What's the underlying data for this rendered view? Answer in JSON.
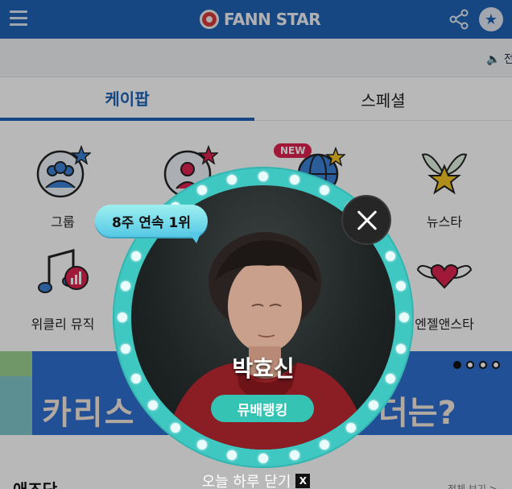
{
  "header": {
    "logo_text": "FANN STAR",
    "menu_icon": "hamburger-icon",
    "share_icon": "share-icon",
    "favorite_icon": "star-icon"
  },
  "notice": {
    "text": "🔈 전"
  },
  "tabs": [
    {
      "label": "케이팝",
      "active": true
    },
    {
      "label": "스페셜",
      "active": false
    }
  ],
  "menu": {
    "new_badge": "NEW",
    "items": [
      {
        "label": "그룹",
        "icon": "group-icon"
      },
      {
        "label": "",
        "icon": "person-icon"
      },
      {
        "label": "",
        "icon": "globe-icon"
      },
      {
        "label": "뉴스타",
        "icon": "new-star-icon"
      },
      {
        "label": "위클리 뮤직",
        "icon": "music-chart-icon"
      },
      {
        "label": "엔젤앤스타",
        "icon": "winged-heart-icon"
      }
    ]
  },
  "banner": {
    "text_left": "카리스",
    "text_right": "더는?"
  },
  "section": {
    "title": "애즈닷",
    "more": "전체 보기 >"
  },
  "popup": {
    "rank_badge": "8주 연속 1위",
    "artist_name": "박효신",
    "category": "뮤배랭킹",
    "close_today": "오늘 하루 닫기",
    "close_today_x": "X"
  },
  "colors": {
    "brand_blue": "#1f63b4",
    "ring_teal": "#3fc7c2",
    "badge_pink": "#e0234e"
  }
}
